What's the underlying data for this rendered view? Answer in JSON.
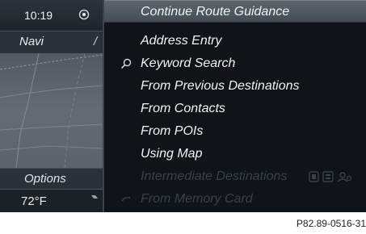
{
  "status": {
    "time": "10:19",
    "icon": "gps-target-icon"
  },
  "left_panel": {
    "navi_label": "Navi",
    "navi_separator": "/",
    "options_label": "Options",
    "temperature": "72°F"
  },
  "menu": {
    "items": [
      {
        "label": "Continue Route Guidance",
        "selected": true,
        "enabled": true
      },
      {
        "label": "Address Entry",
        "enabled": true
      },
      {
        "label": "Keyword Search",
        "enabled": true,
        "icon": "search-icon"
      },
      {
        "label": "From Previous Destinations",
        "enabled": true
      },
      {
        "label": "From Contacts",
        "enabled": true
      },
      {
        "label": "From POIs",
        "enabled": true
      },
      {
        "label": "Using Map",
        "enabled": true
      },
      {
        "label": "Intermediate Destinations",
        "enabled": false,
        "icons": [
          "media-icon",
          "card-icon",
          "person-icon"
        ]
      },
      {
        "label": "From Memory Card",
        "enabled": false,
        "icon": "memory-card-icon"
      }
    ]
  },
  "caption": "P82.89-0516-31",
  "colors": {
    "selected_bg": "#535b62",
    "text": "#f1f4f6",
    "disabled_text": "#3a4148",
    "map": "#5e676d"
  }
}
